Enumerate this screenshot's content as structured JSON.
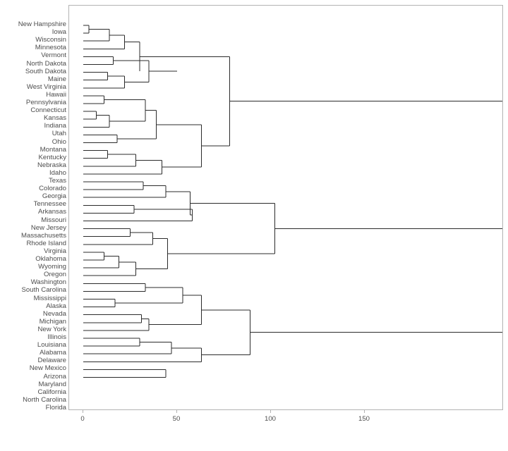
{
  "chart_data": {
    "type": "dendrogram",
    "title": "",
    "xlabel": "",
    "ylabel": "",
    "orientation": "horizontal",
    "axis": {
      "x_ticks": [
        "0",
        "50",
        "100",
        "150"
      ],
      "x_tick_values": [
        0,
        50,
        100,
        150
      ],
      "xlim": [
        0,
        231
      ],
      "grid": false
    },
    "leaf_labels": [
      "New Hampshire",
      "Iowa",
      "Wisconsin",
      "Minnesota",
      "Vermont",
      "North Dakota",
      "South Dakota",
      "Maine",
      "West Virginia",
      "Hawaii",
      "Pennsylvania",
      "Connecticut",
      "Kansas",
      "Indiana",
      "Utah",
      "Ohio",
      "Montana",
      "Kentucky",
      "Nebraska",
      "Idaho",
      "Texas",
      "Colorado",
      "Georgia",
      "Tennessee",
      "Arkansas",
      "Missouri",
      "New Jersey",
      "Massachusetts",
      "Rhode Island",
      "Virginia",
      "Oklahoma",
      "Wyoming",
      "Oregon",
      "Washington",
      "South Carolina",
      "Mississippi",
      "Alaska",
      "Nevada",
      "Michigan",
      "New York",
      "Illinois",
      "Louisiana",
      "Alabama",
      "Delaware",
      "New Mexico",
      "Arizona",
      "Maryland",
      "California",
      "North Carolina",
      "Florida"
    ],
    "merges": [
      {
        "left": 0,
        "right": 1,
        "height": 3.0
      },
      {
        "left": 2,
        "right": 3,
        "height": 6.5
      },
      {
        "left": 4,
        "right": 5,
        "height": 7.0
      },
      {
        "left": 6,
        "right": 7,
        "height": 7.5
      },
      {
        "left": 8,
        "right": 9,
        "height": 5.0
      },
      {
        "left": 10,
        "right": 11,
        "height": 5.5
      },
      {
        "left": 12,
        "right": 13,
        "height": 6.0
      },
      {
        "left": 14,
        "right": 15,
        "height": 4.5
      },
      {
        "left": 16,
        "right": 17,
        "height": 6.0
      },
      {
        "left": 18,
        "right": 19,
        "height": 7.0
      },
      {
        "left": 20,
        "right": 21,
        "height": 8.0
      },
      {
        "left": 22,
        "right": 23,
        "height": 9.0
      },
      {
        "left": 24,
        "right": 25,
        "height": 8.5
      },
      {
        "left": 26,
        "right": 27,
        "height": 12.0
      },
      {
        "left": 28,
        "right": 29,
        "height": 7.0
      },
      {
        "left": 30,
        "right": 31,
        "height": 6.5
      },
      {
        "left": 32,
        "right": 33,
        "height": 8.0
      },
      {
        "left": 34,
        "right": 35,
        "height": 14.0
      },
      {
        "left": 36,
        "right": 37,
        "height": 9.0
      },
      {
        "left": 38,
        "right": 39,
        "height": 4.5
      },
      {
        "left": 40,
        "right": 41,
        "height": 9.5
      },
      {
        "left": 42,
        "right": 43,
        "height": 8.5
      },
      {
        "left": 44,
        "right": 45,
        "height": 8.0
      },
      {
        "left": 46,
        "right": 47,
        "height": 13.5
      },
      {
        "left": 48,
        "right": 49,
        "height": 44.0
      },
      {
        "height": 231.0,
        "root": true
      }
    ],
    "segments": [
      {
        "x1": 0.0,
        "x2": 3.0,
        "y1": 35.0,
        "y2": 35.0
      },
      {
        "x1": 0.0,
        "x2": 3.0,
        "y1": 46.1,
        "y2": 46.1
      },
      {
        "x1": 3.0,
        "x2": 3.0,
        "y1": 35.0,
        "y2": 46.1
      },
      {
        "x1": 3.0,
        "x2": 14.0,
        "y1": 40.5,
        "y2": 40.5
      },
      {
        "x1": 0.0,
        "x2": 14.0,
        "y1": 57.2,
        "y2": 57.2
      },
      {
        "x1": 14.0,
        "x2": 14.0,
        "y1": 40.5,
        "y2": 57.2
      },
      {
        "x1": 14.0,
        "x2": 22.0,
        "y1": 48.9,
        "y2": 48.9
      },
      {
        "x1": 0.0,
        "x2": 22.0,
        "y1": 68.3,
        "y2": 68.3
      },
      {
        "x1": 22.0,
        "x2": 22.0,
        "y1": 48.9,
        "y2": 68.3
      },
      {
        "x1": 22.0,
        "x2": 30.0,
        "y1": 58.6,
        "y2": 58.6
      },
      {
        "x1": 0.0,
        "x2": 16.0,
        "y1": 79.4,
        "y2": 79.4
      },
      {
        "x1": 0.0,
        "x2": 16.0,
        "y1": 90.5,
        "y2": 90.5
      },
      {
        "x1": 16.0,
        "x2": 16.0,
        "y1": 79.4,
        "y2": 90.5
      },
      {
        "x1": 16.0,
        "x2": 35.0,
        "y1": 84.9,
        "y2": 84.9
      },
      {
        "x1": 0.0,
        "x2": 13.0,
        "y1": 101.6,
        "y2": 101.6
      },
      {
        "x1": 0.0,
        "x2": 13.0,
        "y1": 112.7,
        "y2": 112.7
      },
      {
        "x1": 13.0,
        "x2": 13.0,
        "y1": 101.6,
        "y2": 112.7
      },
      {
        "x1": 13.0,
        "x2": 22.0,
        "y1": 107.1,
        "y2": 107.1
      },
      {
        "x1": 0.0,
        "x2": 22.0,
        "y1": 123.8,
        "y2": 123.8
      },
      {
        "x1": 22.0,
        "x2": 22.0,
        "y1": 107.1,
        "y2": 123.8
      },
      {
        "x1": 22.0,
        "x2": 35.0,
        "y1": 115.5,
        "y2": 115.5
      },
      {
        "x1": 35.0,
        "x2": 35.0,
        "y1": 84.9,
        "y2": 115.5
      },
      {
        "x1": 35.0,
        "x2": 50.0,
        "y1": 100.2,
        "y2": 100.2
      },
      {
        "x1": 30.0,
        "x2": 30.0,
        "y1": 58.6,
        "y2": 100.2
      },
      {
        "x1": 30.0,
        "x2": 78.0,
        "y1": 79.4,
        "y2": 79.4
      },
      {
        "x1": 0.0,
        "x2": 11.0,
        "y1": 134.9,
        "y2": 134.9
      },
      {
        "x1": 0.0,
        "x2": 11.0,
        "y1": 146.0,
        "y2": 146.0
      },
      {
        "x1": 11.0,
        "x2": 11.0,
        "y1": 134.9,
        "y2": 146.0
      },
      {
        "x1": 11.0,
        "x2": 33.0,
        "y1": 140.5,
        "y2": 140.5
      },
      {
        "x1": 0.0,
        "x2": 7.0,
        "y1": 157.1,
        "y2": 157.1
      },
      {
        "x1": 0.0,
        "x2": 7.0,
        "y1": 168.2,
        "y2": 168.2
      },
      {
        "x1": 7.0,
        "x2": 7.0,
        "y1": 157.1,
        "y2": 168.2
      },
      {
        "x1": 7.0,
        "x2": 14.0,
        "y1": 162.7,
        "y2": 162.7
      },
      {
        "x1": 0.0,
        "x2": 14.0,
        "y1": 179.3,
        "y2": 179.3
      },
      {
        "x1": 14.0,
        "x2": 14.0,
        "y1": 162.7,
        "y2": 179.3
      },
      {
        "x1": 14.0,
        "x2": 33.0,
        "y1": 171.0,
        "y2": 171.0
      },
      {
        "x1": 33.0,
        "x2": 33.0,
        "y1": 140.5,
        "y2": 171.0
      },
      {
        "x1": 33.0,
        "x2": 39.0,
        "y1": 155.7,
        "y2": 155.7
      },
      {
        "x1": 0.0,
        "x2": 18.0,
        "y1": 190.4,
        "y2": 190.4
      },
      {
        "x1": 0.0,
        "x2": 18.0,
        "y1": 201.5,
        "y2": 201.5
      },
      {
        "x1": 18.0,
        "x2": 18.0,
        "y1": 190.4,
        "y2": 201.5
      },
      {
        "x1": 18.0,
        "x2": 39.0,
        "y1": 196.0,
        "y2": 196.0
      },
      {
        "x1": 39.0,
        "x2": 39.0,
        "y1": 155.7,
        "y2": 196.0
      },
      {
        "x1": 39.0,
        "x2": 63.0,
        "y1": 175.8,
        "y2": 175.8
      },
      {
        "x1": 0.0,
        "x2": 13.0,
        "y1": 212.6,
        "y2": 212.6
      },
      {
        "x1": 0.0,
        "x2": 13.0,
        "y1": 223.7,
        "y2": 223.7
      },
      {
        "x1": 13.0,
        "x2": 13.0,
        "y1": 212.6,
        "y2": 223.7
      },
      {
        "x1": 13.0,
        "x2": 28.0,
        "y1": 218.1,
        "y2": 218.1
      },
      {
        "x1": 0.0,
        "x2": 28.0,
        "y1": 234.8,
        "y2": 234.8
      },
      {
        "x1": 28.0,
        "x2": 28.0,
        "y1": 218.1,
        "y2": 234.8
      },
      {
        "x1": 28.0,
        "x2": 42.0,
        "y1": 226.5,
        "y2": 226.5
      },
      {
        "x1": 0.0,
        "x2": 42.0,
        "y1": 245.9,
        "y2": 245.9
      },
      {
        "x1": 42.0,
        "x2": 42.0,
        "y1": 226.5,
        "y2": 245.9
      },
      {
        "x1": 42.0,
        "x2": 63.0,
        "y1": 236.2,
        "y2": 236.2
      },
      {
        "x1": 63.0,
        "x2": 63.0,
        "y1": 175.8,
        "y2": 236.2
      },
      {
        "x1": 63.0,
        "x2": 78.0,
        "y1": 206.0,
        "y2": 206.0
      },
      {
        "x1": 78.0,
        "x2": 78.0,
        "y1": 79.4,
        "y2": 206.0
      },
      {
        "x1": 78.0,
        "x2": 231.0,
        "y1": 142.7,
        "y2": 142.7
      },
      {
        "x1": 0.0,
        "x2": 32.0,
        "y1": 257.0,
        "y2": 257.0
      },
      {
        "x1": 0.0,
        "x2": 32.0,
        "y1": 268.1,
        "y2": 268.1
      },
      {
        "x1": 32.0,
        "x2": 32.0,
        "y1": 257.0,
        "y2": 268.1
      },
      {
        "x1": 32.0,
        "x2": 44.0,
        "y1": 262.6,
        "y2": 262.6
      },
      {
        "x1": 0.0,
        "x2": 44.0,
        "y1": 279.2,
        "y2": 279.2
      },
      {
        "x1": 44.0,
        "x2": 44.0,
        "y1": 262.6,
        "y2": 279.2
      },
      {
        "x1": 44.0,
        "x2": 57.0,
        "y1": 271.0,
        "y2": 271.0
      },
      {
        "x1": 0.0,
        "x2": 27.0,
        "y1": 290.3,
        "y2": 290.3
      },
      {
        "x1": 0.0,
        "x2": 27.0,
        "y1": 301.4,
        "y2": 301.4
      },
      {
        "x1": 27.0,
        "x2": 27.0,
        "y1": 290.3,
        "y2": 301.4
      },
      {
        "x1": 27.0,
        "x2": 58.0,
        "y1": 295.8,
        "y2": 295.8
      },
      {
        "x1": 0.0,
        "x2": 58.0,
        "y1": 312.5,
        "y2": 312.5
      },
      {
        "x1": 58.0,
        "x2": 58.0,
        "y1": 295.8,
        "y2": 312.5
      },
      {
        "x1": 58.0,
        "x2": 57.0,
        "y1": 304.2,
        "y2": 304.2
      },
      {
        "x1": 57.0,
        "x2": 57.0,
        "y1": 271.0,
        "y2": 304.2
      },
      {
        "x1": 57.0,
        "x2": 102.0,
        "y1": 287.6,
        "y2": 287.6
      },
      {
        "x1": 0.0,
        "x2": 25.0,
        "y1": 323.6,
        "y2": 323.6
      },
      {
        "x1": 0.0,
        "x2": 25.0,
        "y1": 334.7,
        "y2": 334.7
      },
      {
        "x1": 25.0,
        "x2": 25.0,
        "y1": 323.6,
        "y2": 334.7
      },
      {
        "x1": 25.0,
        "x2": 37.0,
        "y1": 329.1,
        "y2": 329.1
      },
      {
        "x1": 0.0,
        "x2": 37.0,
        "y1": 345.8,
        "y2": 345.8
      },
      {
        "x1": 37.0,
        "x2": 37.0,
        "y1": 329.1,
        "y2": 345.8
      },
      {
        "x1": 37.0,
        "x2": 45.0,
        "y1": 337.5,
        "y2": 337.5
      },
      {
        "x1": 0.0,
        "x2": 11.0,
        "y1": 356.9,
        "y2": 356.9
      },
      {
        "x1": 0.0,
        "x2": 11.0,
        "y1": 368.0,
        "y2": 368.0
      },
      {
        "x1": 11.0,
        "x2": 11.0,
        "y1": 356.9,
        "y2": 368.0
      },
      {
        "x1": 11.0,
        "x2": 19.0,
        "y1": 362.5,
        "y2": 362.5
      },
      {
        "x1": 0.0,
        "x2": 19.0,
        "y1": 379.1,
        "y2": 379.1
      },
      {
        "x1": 19.0,
        "x2": 19.0,
        "y1": 362.5,
        "y2": 379.1
      },
      {
        "x1": 19.0,
        "x2": 28.0,
        "y1": 370.8,
        "y2": 370.8
      },
      {
        "x1": 0.0,
        "x2": 28.0,
        "y1": 390.2,
        "y2": 390.2
      },
      {
        "x1": 28.0,
        "x2": 28.0,
        "y1": 370.8,
        "y2": 390.2
      },
      {
        "x1": 28.0,
        "x2": 45.0,
        "y1": 380.5,
        "y2": 380.5
      },
      {
        "x1": 45.0,
        "x2": 45.0,
        "y1": 337.5,
        "y2": 380.5
      },
      {
        "x1": 45.0,
        "x2": 102.0,
        "y1": 359.0,
        "y2": 359.0
      },
      {
        "x1": 102.0,
        "x2": 102.0,
        "y1": 287.6,
        "y2": 359.0
      },
      {
        "x1": 102.0,
        "x2": 231.0,
        "y1": 323.3,
        "y2": 323.3
      },
      {
        "x1": 0.0,
        "x2": 33.0,
        "y1": 401.3,
        "y2": 401.3
      },
      {
        "x1": 0.0,
        "x2": 33.0,
        "y1": 412.4,
        "y2": 412.4
      },
      {
        "x1": 33.0,
        "x2": 33.0,
        "y1": 401.3,
        "y2": 412.4
      },
      {
        "x1": 33.0,
        "x2": 53.0,
        "y1": 406.9,
        "y2": 406.9
      },
      {
        "x1": 0.0,
        "x2": 17.0,
        "y1": 423.5,
        "y2": 423.5
      },
      {
        "x1": 0.0,
        "x2": 17.0,
        "y1": 434.6,
        "y2": 434.6
      },
      {
        "x1": 17.0,
        "x2": 17.0,
        "y1": 423.5,
        "y2": 434.6
      },
      {
        "x1": 17.0,
        "x2": 53.0,
        "y1": 429.1,
        "y2": 429.1
      },
      {
        "x1": 53.0,
        "x2": 53.0,
        "y1": 406.9,
        "y2": 429.1
      },
      {
        "x1": 53.0,
        "x2": 63.0,
        "y1": 418.0,
        "y2": 418.0
      },
      {
        "x1": 0.0,
        "x2": 31.0,
        "y1": 445.7,
        "y2": 445.7
      },
      {
        "x1": 0.0,
        "x2": 31.0,
        "y1": 456.8,
        "y2": 456.8
      },
      {
        "x1": 31.0,
        "x2": 31.0,
        "y1": 445.7,
        "y2": 456.8
      },
      {
        "x1": 31.0,
        "x2": 35.0,
        "y1": 451.3,
        "y2": 451.3
      },
      {
        "x1": 0.0,
        "x2": 35.0,
        "y1": 467.9,
        "y2": 467.9
      },
      {
        "x1": 35.0,
        "x2": 35.0,
        "y1": 451.3,
        "y2": 467.9
      },
      {
        "x1": 35.0,
        "x2": 63.0,
        "y1": 459.6,
        "y2": 459.6
      },
      {
        "x1": 63.0,
        "x2": 63.0,
        "y1": 418.0,
        "y2": 459.6
      },
      {
        "x1": 63.0,
        "x2": 89.0,
        "y1": 438.8,
        "y2": 438.8
      },
      {
        "x1": 0.0,
        "x2": 30.0,
        "y1": 479.0,
        "y2": 479.0
      },
      {
        "x1": 0.0,
        "x2": 30.0,
        "y1": 490.1,
        "y2": 490.1
      },
      {
        "x1": 30.0,
        "x2": 30.0,
        "y1": 479.0,
        "y2": 490.1
      },
      {
        "x1": 30.0,
        "x2": 47.0,
        "y1": 484.6,
        "y2": 484.6
      },
      {
        "x1": 0.0,
        "x2": 47.0,
        "y1": 501.2,
        "y2": 501.2
      },
      {
        "x1": 47.0,
        "x2": 47.0,
        "y1": 484.6,
        "y2": 501.2
      },
      {
        "x1": 47.0,
        "x2": 63.0,
        "y1": 492.9,
        "y2": 492.9
      },
      {
        "x1": 0.0,
        "x2": 63.0,
        "y1": 512.3,
        "y2": 512.3
      },
      {
        "x1": 63.0,
        "x2": 63.0,
        "y1": 492.9,
        "y2": 512.3
      },
      {
        "x1": 63.0,
        "x2": 89.0,
        "y1": 502.6,
        "y2": 502.6
      },
      {
        "x1": 89.0,
        "x2": 89.0,
        "y1": 438.8,
        "y2": 502.6
      },
      {
        "x1": 89.0,
        "x2": 231.0,
        "y1": 470.7,
        "y2": 470.7
      },
      {
        "x1": 0.0,
        "x2": 44.0,
        "y1": 523.4,
        "y2": 523.4
      },
      {
        "x1": 0.0,
        "x2": 44.0,
        "y1": 534.5,
        "y2": 534.5
      },
      {
        "x1": 44.0,
        "x2": 44.0,
        "y1": 523.4,
        "y2": 534.5
      },
      {
        "x1": 231.0,
        "x2": 231.0,
        "y1": 142.7,
        "y2": 470.7
      }
    ]
  },
  "plot": {
    "line_color": "#2b2b2b",
    "panel_border_color": "#b3b3b3",
    "background_color": "#ffffff",
    "tick_label_color": "#4d4d4d"
  }
}
